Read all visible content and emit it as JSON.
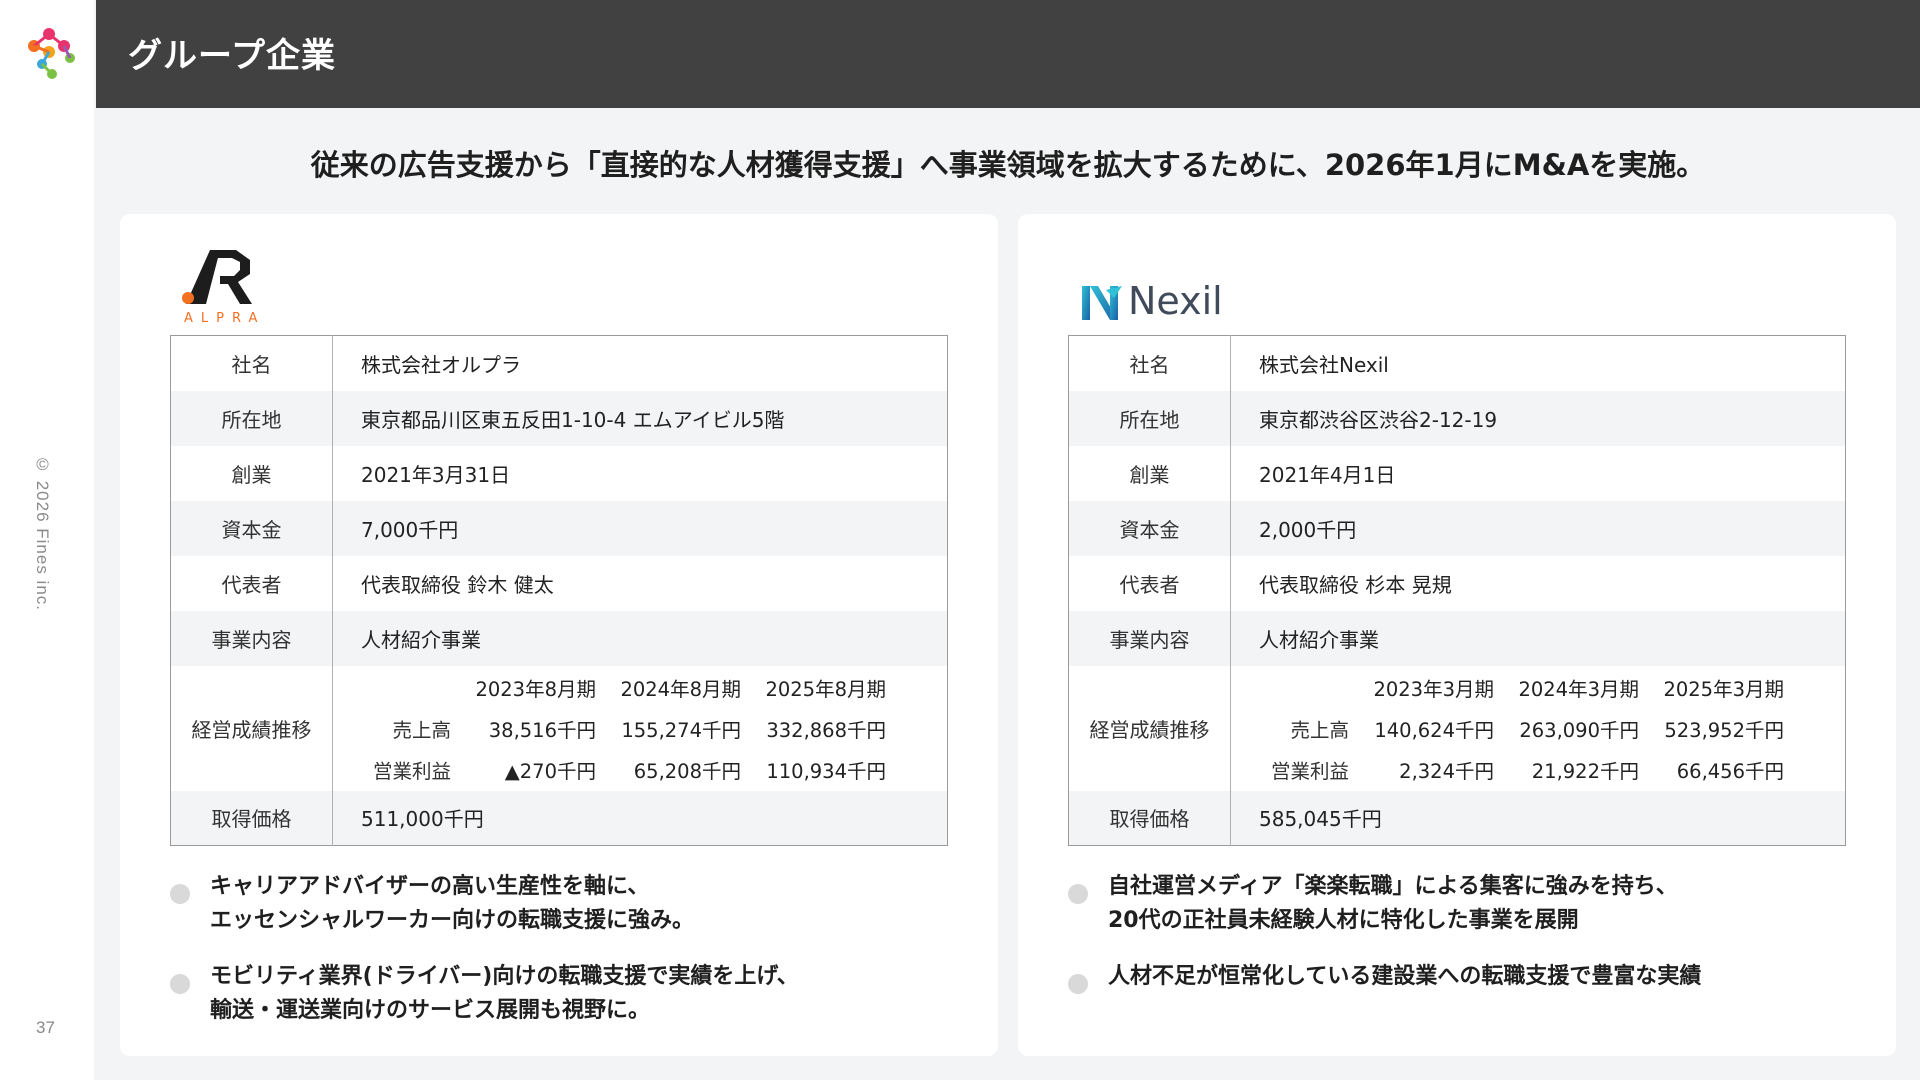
{
  "page": {
    "title": "グループ企業",
    "headline": "従来の広告支援から「直接的な人材獲得支援」へ事業領域を拡大するために、2026年1月にM&Aを実施。",
    "copyright": "© 2026 Fines inc.",
    "page_number": "37"
  },
  "brand_colors": {
    "header": "#414141",
    "accent_orange": "#f36f21",
    "nexil_teal": "#1aa3c4"
  },
  "companies": [
    {
      "logo": {
        "mark": "AR",
        "sub": "ALPRA"
      },
      "rows": [
        {
          "label": "社名",
          "value": "株式会社オルプラ"
        },
        {
          "label": "所在地",
          "value": "東京都品川区東五反田1-10-4 エムアイビル5階"
        },
        {
          "label": "創業",
          "value": "2021年3月31日"
        },
        {
          "label": "資本金",
          "value": "7,000千円"
        },
        {
          "label": "代表者",
          "value": "代表取締役 鈴木 健太"
        },
        {
          "label": "事業内容",
          "value": "人材紹介事業"
        }
      ],
      "performance": {
        "label": "経営成績推移",
        "periods": [
          "2023年8月期",
          "2024年8月期",
          "2025年8月期"
        ],
        "sales_label": "売上高",
        "sales": [
          "38,516千円",
          "155,274千円",
          "332,868千円"
        ],
        "profit_label": "営業利益",
        "profit": [
          "▲270千円",
          "65,208千円",
          "110,934千円"
        ]
      },
      "price": {
        "label": "取得価格",
        "value": "511,000千円"
      },
      "bullets": [
        "キャリアアドバイザーの高い生産性を軸に、\nエッセンシャルワーカー向けの転職支援に強み。",
        "モビリティ業界(ドライバー)向けの転職支援で実績を上げ、\n輸送・運送業向けのサービス展開も視野に。"
      ]
    },
    {
      "logo": {
        "mark": "N",
        "sub": "Nexil"
      },
      "rows": [
        {
          "label": "社名",
          "value": "株式会社Nexil"
        },
        {
          "label": "所在地",
          "value": "東京都渋谷区渋谷2-12-19"
        },
        {
          "label": "創業",
          "value": "2021年4月1日"
        },
        {
          "label": "資本金",
          "value": "2,000千円"
        },
        {
          "label": "代表者",
          "value": "代表取締役 杉本 晃規"
        },
        {
          "label": "事業内容",
          "value": "人材紹介事業"
        }
      ],
      "performance": {
        "label": "経営成績推移",
        "periods": [
          "2023年3月期",
          "2024年3月期",
          "2025年3月期"
        ],
        "sales_label": "売上高",
        "sales": [
          "140,624千円",
          "263,090千円",
          "523,952千円"
        ],
        "profit_label": "営業利益",
        "profit": [
          "2,324千円",
          "21,922千円",
          "66,456千円"
        ]
      },
      "price": {
        "label": "取得価格",
        "value": "585,045千円"
      },
      "bullets": [
        "自社運営メディア「楽楽転職」による集客に強みを持ち、\n20代の正社員未経験人材に特化した事業を展開",
        "人材不足が恒常化している建設業への転職支援で豊富な実績"
      ]
    }
  ]
}
